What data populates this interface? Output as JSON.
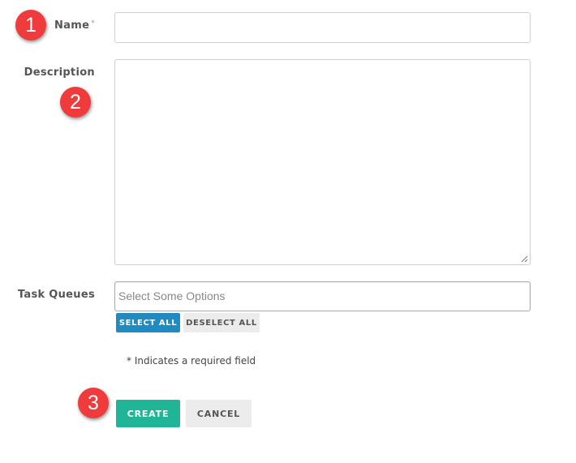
{
  "form": {
    "name": {
      "label": "Name",
      "required_mark": "*",
      "value": ""
    },
    "description": {
      "label": "Description",
      "value": ""
    },
    "task_queues": {
      "label": "Task Queues",
      "placeholder": "Select Some Options",
      "select_all_label": "SELECT ALL",
      "deselect_all_label": "DESELECT ALL"
    },
    "required_note": "* Indicates a required field",
    "create_label": "CREATE",
    "cancel_label": "CANCEL"
  },
  "callouts": [
    "1",
    "2",
    "3"
  ],
  "colors": {
    "select_all_button": "#1f8bc0",
    "create_button": "#20b596",
    "secondary_button": "#ececec",
    "callout_badge": "#ef3b3b",
    "input_border": "#cfcfcf"
  }
}
